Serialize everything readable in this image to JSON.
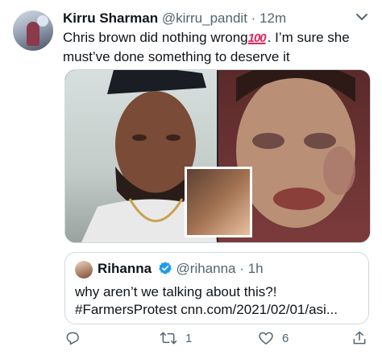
{
  "tweet": {
    "author_name": "Kirru Sharman",
    "handle": "@kirru_pandit",
    "separator": "·",
    "time": "12m",
    "text_part1": "Chris brown did nothing wrong",
    "emoji_text": "100",
    "text_part2": ". I’m sure she must’ve done something to deserve it"
  },
  "quoted_tweet": {
    "author_name": "Rihanna",
    "handle": "@rihanna",
    "separator": "·",
    "time": "1h",
    "text_line1": "why aren’t we talking about this?!",
    "text_line2": "#FarmersProtest cnn.com/2021/02/01/asi..."
  },
  "actions": {
    "reply_count": "",
    "retweet_count": "1",
    "like_count": "6",
    "share_count": ""
  },
  "colors": {
    "text": "#0f1419",
    "secondary": "#536471",
    "verified": "#1d9bf0",
    "border": "#cfd9de"
  },
  "icons": [
    "caret-down-icon",
    "verified-badge-icon",
    "reply-icon",
    "retweet-icon",
    "like-icon",
    "share-icon"
  ]
}
